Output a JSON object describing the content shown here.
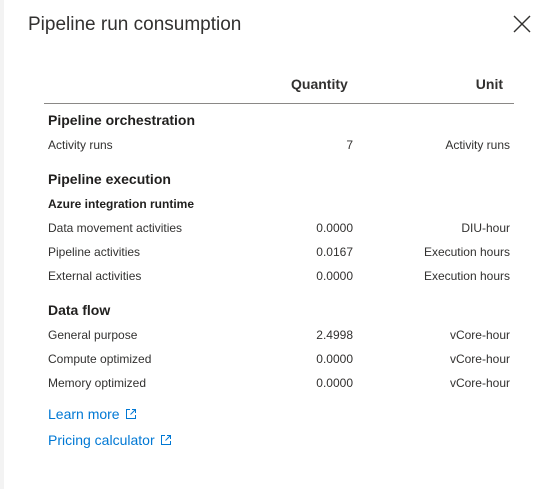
{
  "panel": {
    "title": "Pipeline run consumption",
    "close_icon": "close-icon"
  },
  "columns": {
    "quantity": "Quantity",
    "unit": "Unit"
  },
  "orchestration": {
    "heading": "Pipeline orchestration",
    "rows": [
      {
        "label": "Activity runs",
        "quantity": "7",
        "unit": "Activity runs"
      }
    ]
  },
  "execution": {
    "heading": "Pipeline execution",
    "subheading": "Azure integration runtime",
    "rows": [
      {
        "label": "Data movement activities",
        "quantity": "0.0000",
        "unit": "DIU-hour"
      },
      {
        "label": "Pipeline activities",
        "quantity": "0.0167",
        "unit": "Execution hours"
      },
      {
        "label": "External activities",
        "quantity": "0.0000",
        "unit": "Execution hours"
      }
    ]
  },
  "dataflow": {
    "heading": "Data flow",
    "rows": [
      {
        "label": "General purpose",
        "quantity": "2.4998",
        "unit": "vCore-hour"
      },
      {
        "label": "Compute optimized",
        "quantity": "0.0000",
        "unit": "vCore-hour"
      },
      {
        "label": "Memory optimized",
        "quantity": "0.0000",
        "unit": "vCore-hour"
      }
    ]
  },
  "links": {
    "learn_more": "Learn more",
    "pricing_calculator": "Pricing calculator",
    "icon": "external-link-icon"
  },
  "colors": {
    "link": "#0078d4",
    "text": "#323130",
    "divider": "#8a8886"
  }
}
